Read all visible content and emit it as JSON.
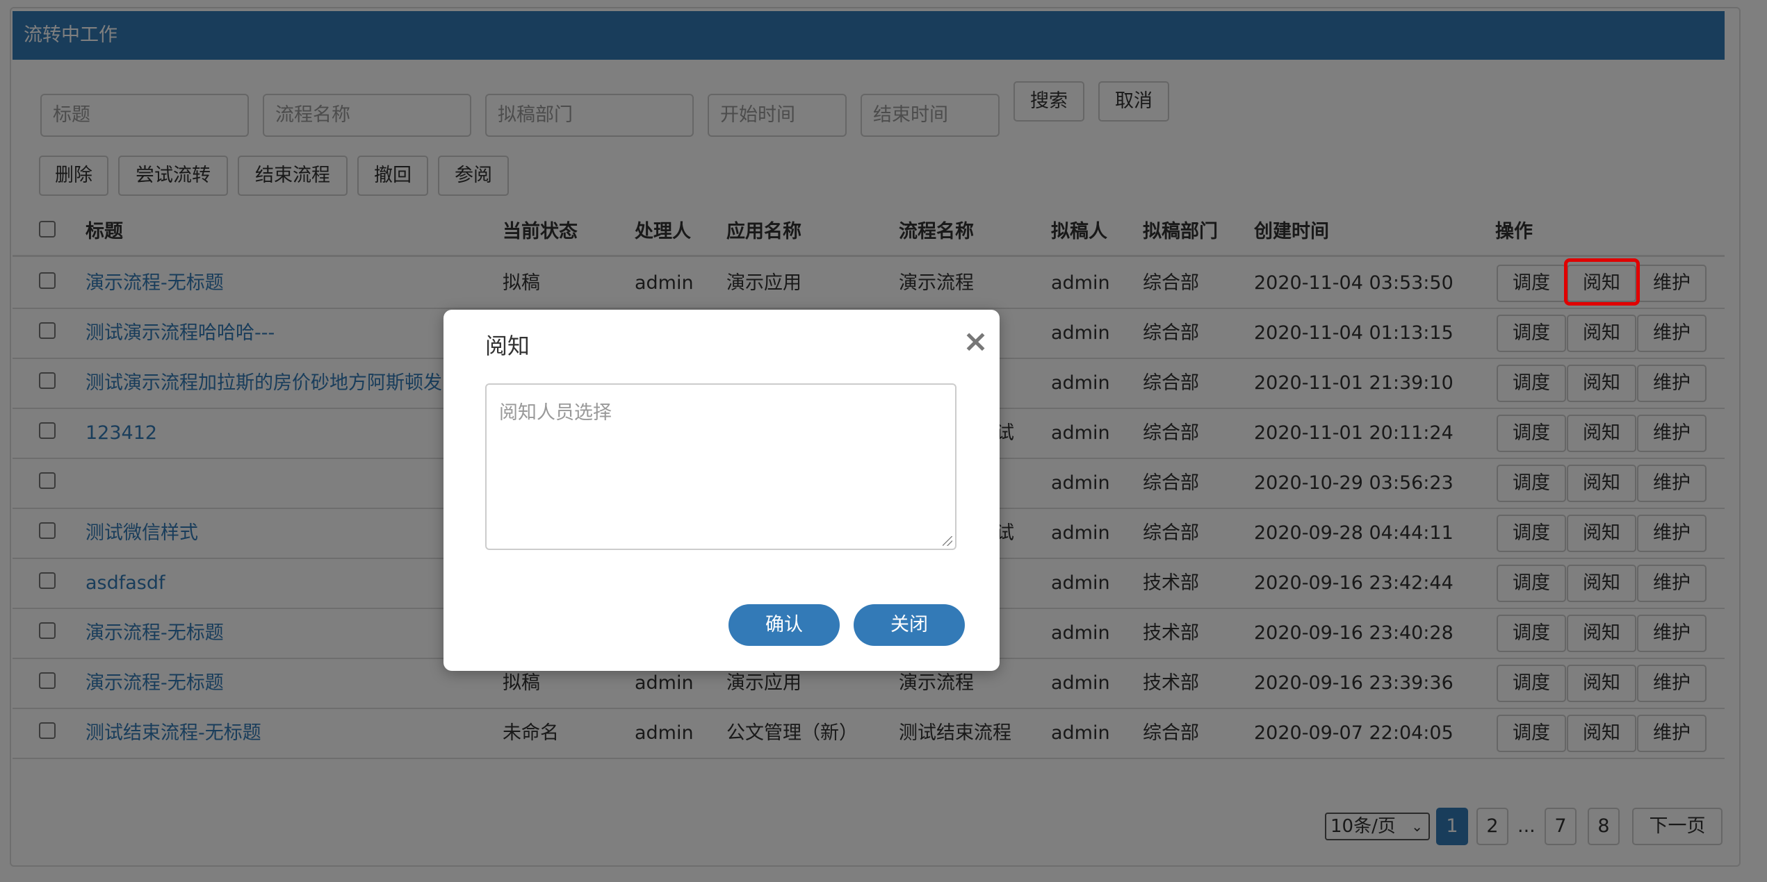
{
  "panel": {
    "title": "流转中工作"
  },
  "search": {
    "title_placeholder": "标题",
    "flow_placeholder": "流程名称",
    "dept_placeholder": "拟稿部门",
    "start_placeholder": "开始时间",
    "end_placeholder": "结束时间",
    "search_label": "搜索",
    "cancel_label": "取消"
  },
  "toolbar": {
    "delete_label": "删除",
    "try_flow_label": "尝试流转",
    "end_flow_label": "结束流程",
    "revoke_label": "撤回",
    "refer_label": "参阅"
  },
  "table": {
    "headers": {
      "title": "标题",
      "status": "当前状态",
      "handler": "处理人",
      "app": "应用名称",
      "flow": "流程名称",
      "drafter": "拟稿人",
      "dept": "拟稿部门",
      "created": "创建时间",
      "ops": "操作"
    },
    "op_labels": {
      "dispatch": "调度",
      "read": "阅知",
      "maintain": "维护"
    },
    "rows": [
      {
        "title": "演示流程-无标题",
        "status": "拟稿",
        "handler": "admin",
        "app": "演示应用",
        "flow": "演示流程",
        "flow_tail": "",
        "drafter": "admin",
        "dept": "综合部",
        "created": "2020-11-04 03:53:50"
      },
      {
        "title": "测试演示流程哈哈哈---",
        "status": "",
        "handler": "",
        "app": "",
        "flow": "",
        "flow_tail": "",
        "drafter": "admin",
        "dept": "综合部",
        "created": "2020-11-04 01:13:15"
      },
      {
        "title": "测试演示流程加拉斯的房价砂地方阿斯顿发",
        "status": "",
        "handler": "",
        "app": "",
        "flow": "",
        "flow_tail": "",
        "drafter": "admin",
        "dept": "综合部",
        "created": "2020-11-01 21:39:10"
      },
      {
        "title": "123412",
        "status": "",
        "handler": "",
        "app": "",
        "flow": "",
        "flow_tail": "试",
        "drafter": "admin",
        "dept": "综合部",
        "created": "2020-11-01 20:11:24"
      },
      {
        "title": "",
        "status": "",
        "handler": "",
        "app": "",
        "flow": "",
        "flow_tail": "",
        "drafter": "admin",
        "dept": "综合部",
        "created": "2020-10-29 03:56:23"
      },
      {
        "title": "测试微信样式",
        "status": "",
        "handler": "",
        "app": "",
        "flow": "",
        "flow_tail": "试",
        "drafter": "admin",
        "dept": "综合部",
        "created": "2020-09-28 04:44:11"
      },
      {
        "title": "asdfasdf",
        "status": "",
        "handler": "",
        "app": "",
        "flow": "",
        "flow_tail": "",
        "drafter": "admin",
        "dept": "技术部",
        "created": "2020-09-16 23:42:44"
      },
      {
        "title": "演示流程-无标题",
        "status": "",
        "handler": "",
        "app": "",
        "flow": "",
        "flow_tail": "",
        "drafter": "admin",
        "dept": "技术部",
        "created": "2020-09-16 23:40:28"
      },
      {
        "title": "演示流程-无标题",
        "status": "拟稿",
        "handler": "admin",
        "app": "演示应用",
        "flow": "演示流程",
        "flow_tail": "",
        "drafter": "admin",
        "dept": "技术部",
        "created": "2020-09-16 23:39:36"
      },
      {
        "title": "测试结束流程-无标题",
        "status": "未命名",
        "handler": "admin",
        "app": "公文管理（新）",
        "flow": "测试结束流程",
        "flow_tail": "",
        "drafter": "admin",
        "dept": "综合部",
        "created": "2020-09-07 22:04:05"
      }
    ]
  },
  "pager": {
    "page_size": "10条/页",
    "pages": [
      "1",
      "2",
      "...",
      "7",
      "8"
    ],
    "next_label": "下一页"
  },
  "modal": {
    "title": "阅知",
    "close_glyph": "×",
    "textarea_placeholder": "阅知人员选择",
    "confirm_label": "确认",
    "close_label": "关闭"
  },
  "colors": {
    "primary": "#337ab7",
    "highlight": "#e00000"
  }
}
